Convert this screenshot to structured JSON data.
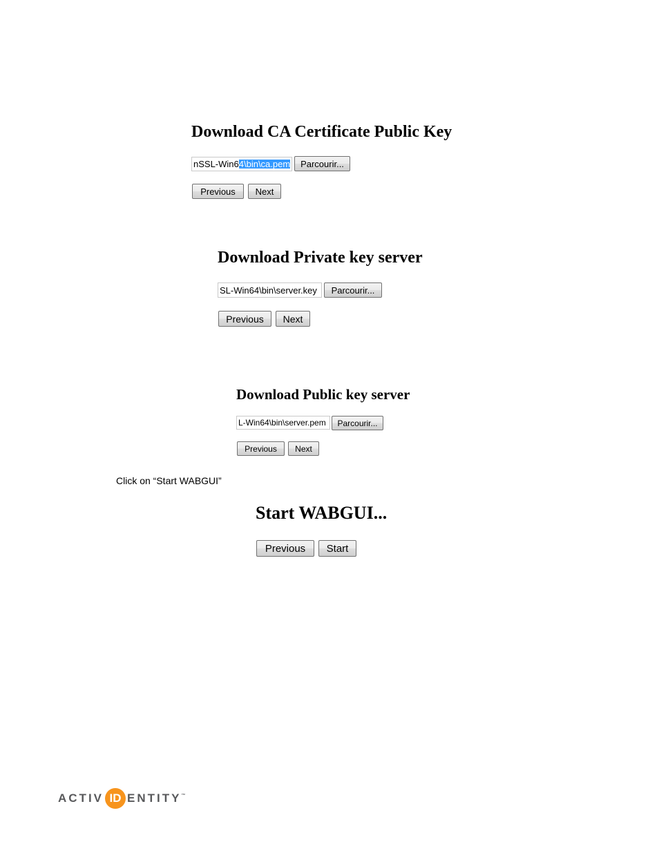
{
  "steps": [
    {
      "title": "Download CA Certificate Public Key",
      "file_value_unselected": "nSSL-Win6",
      "file_value_selected": "4\\bin\\ca.pem",
      "browse_label": "Parcourir...",
      "previous_label": "Previous",
      "next_label": "Next"
    },
    {
      "title": "Download Private key server",
      "file_value": "SL-Win64\\bin\\server.key",
      "browse_label": "Parcourir...",
      "previous_label": "Previous",
      "next_label": "Next"
    },
    {
      "title": "Download Public key server",
      "file_value": "L-Win64\\bin\\server.pem",
      "browse_label": "Parcourir...",
      "previous_label": "Previous",
      "next_label": "Next"
    }
  ],
  "instruction": "Click on “Start WABGUI”",
  "start_step": {
    "title": "Start WABGUI...",
    "previous_label": "Previous",
    "start_label": "Start"
  },
  "logo": {
    "prefix": "ACTIV",
    "badge": "ID",
    "suffix": "ENTITY",
    "trademark": "™",
    "badge_color": "#f7941d"
  }
}
